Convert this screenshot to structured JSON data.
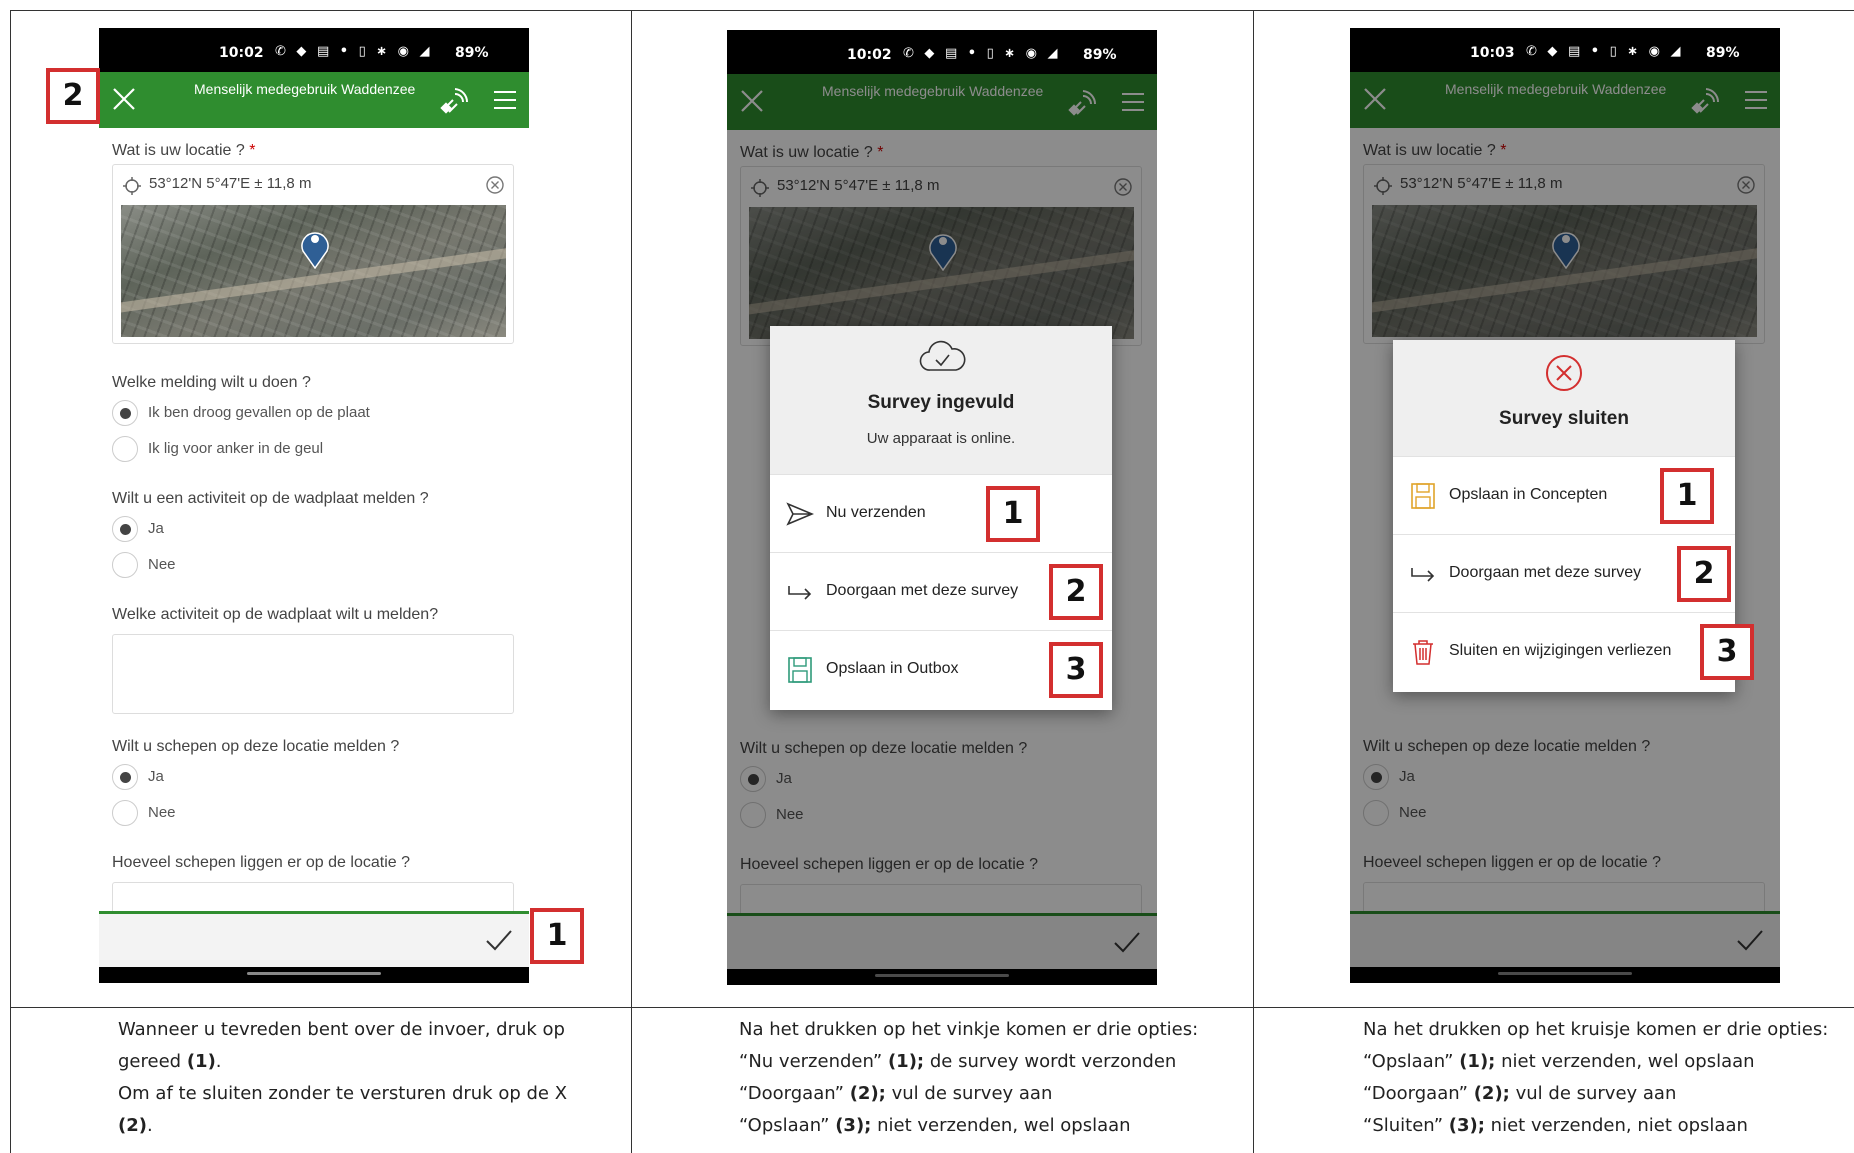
{
  "status": {
    "time_a": "10:02",
    "time_b": "10:02",
    "time_c": "10:03",
    "battery": "89%"
  },
  "app": {
    "title": "Menselijk medegebruik Waddenzee"
  },
  "form": {
    "q_location": "Wat is uw locatie ?",
    "required_mark": "*",
    "location_value": "53°12'N 5°47'E ± 11,8 m",
    "q_report": "Welke melding wilt u doen ?",
    "report_opt1": "Ik ben droog gevallen op de plaat",
    "report_opt2": "Ik lig voor anker in de geul",
    "q_activity": "Wilt u een activiteit op de wadplaat melden ?",
    "yes": "Ja",
    "no": "Nee",
    "q_which_activity": "Welke activiteit op de wadplaat wilt u melden?",
    "q_ships": "Wilt u schepen op deze locatie melden ?",
    "q_ship_count": "Hoeveel schepen liggen er op de locatie ?"
  },
  "dialog_submit": {
    "title": "Survey ingevuld",
    "subtitle": "Uw apparaat is online.",
    "opt_send": "Nu verzenden",
    "opt_continue": "Doorgaan met deze survey",
    "opt_outbox": "Opslaan in Outbox"
  },
  "dialog_close": {
    "title": "Survey sluiten",
    "opt_drafts": "Opslaan in Concepten",
    "opt_continue": "Doorgaan met deze survey",
    "opt_discard": "Sluiten en wijzigingen verliezen"
  },
  "callouts": {
    "one": "1",
    "two": "2",
    "three": "3"
  },
  "captions": {
    "col1_line1": "Wanneer u tevreden bent over de invoer, druk op",
    "col1_line2a": "gereed ",
    "col1_line2b": "(1)",
    "col1_line2c": ".",
    "col1_line3": "Om af te sluiten zonder te versturen druk op de X",
    "col1_line4a": "(2)",
    "col1_line4b": ".",
    "col2_line1": "Na het drukken op het vinkje komen er drie opties:",
    "col2_line2a": "“Nu verzenden” ",
    "col2_line2b": "(1);",
    "col2_line2c": " de survey wordt verzonden",
    "col2_line3a": "“Doorgaan” ",
    "col2_line3b": "(2);",
    "col2_line3c": " vul de survey aan",
    "col2_line4a": "“Opslaan” ",
    "col2_line4b": "(3);",
    "col2_line4c": " niet verzenden, wel opslaan",
    "col3_line1": "Na het drukken op het kruisje komen er drie opties:",
    "col3_line2a": "“Opslaan” ",
    "col3_line2b": "(1);",
    "col3_line2c": " niet verzenden, wel opslaan",
    "col3_line3a": "“Doorgaan” ",
    "col3_line3b": "(2);",
    "col3_line3c": " vul de survey aan",
    "col3_line4a": "“Sluiten” ",
    "col3_line4b": "(3);",
    "col3_line4c": " niet verzenden, niet opslaan"
  },
  "colors": {
    "appbar": "#2f8d2f",
    "callout_border": "#d32f2f",
    "pin": "#2f5f95"
  }
}
